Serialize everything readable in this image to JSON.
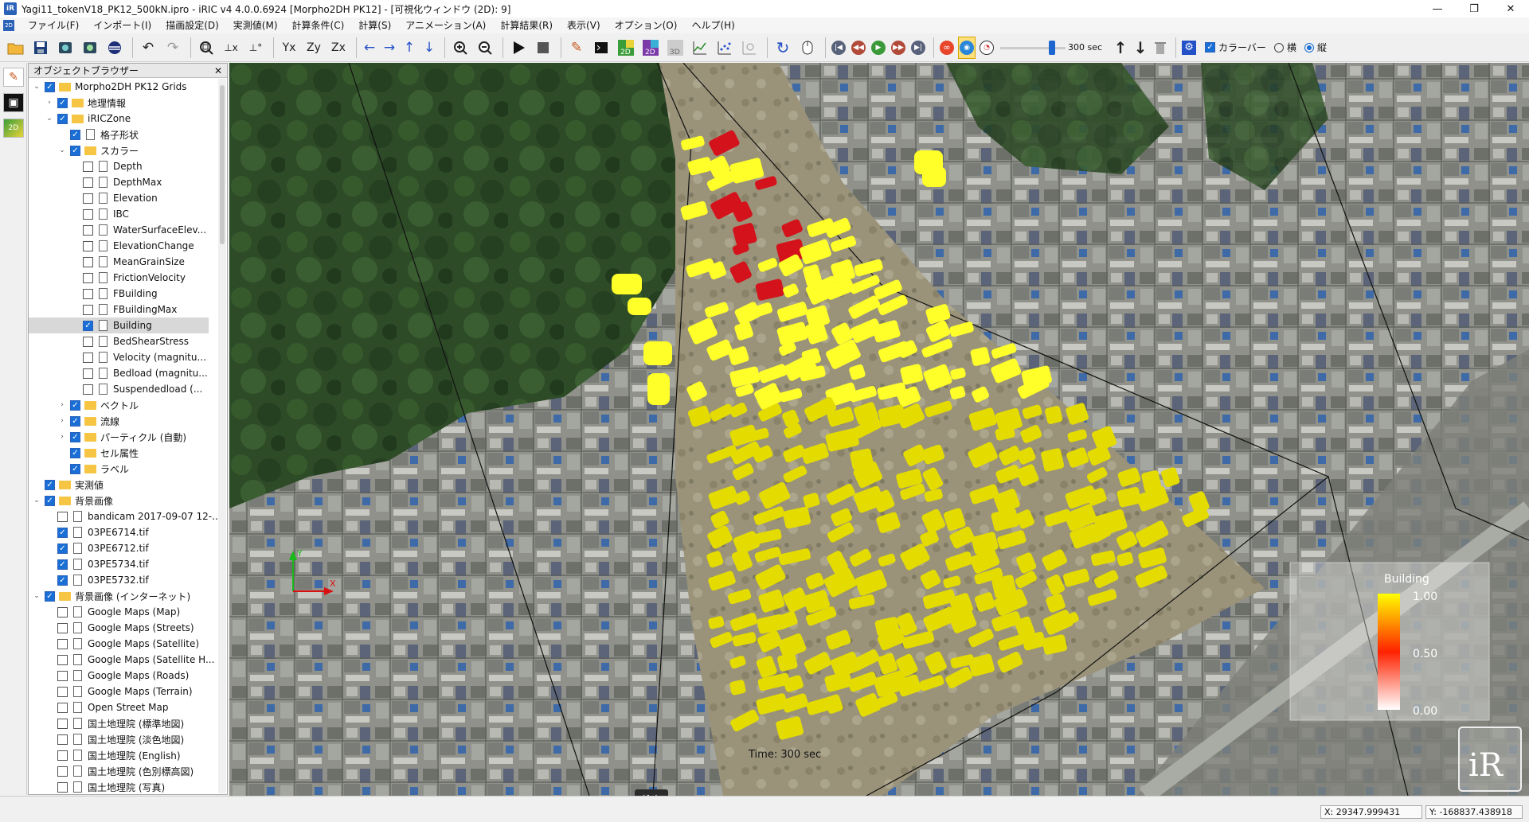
{
  "window": {
    "title": "Yagi11_tokenV18_PK12_500kN.ipro - iRIC v4 4.0.0.6924 [Morpho2DH PK12] - [可視化ウィンドウ (2D): 9]",
    "app_icon": "iR",
    "minimize": "—",
    "maximize": "❐",
    "close": "✕"
  },
  "menu": {
    "subwindow_icon": "2D",
    "items": [
      "ファイル(F)",
      "インポート(I)",
      "描画設定(D)",
      "実測値(M)",
      "計算条件(C)",
      "計算(S)",
      "アニメーション(A)",
      "計算結果(R)",
      "表示(V)",
      "オプション(O)",
      "ヘルプ(H)"
    ]
  },
  "toolbar": {
    "time_label": "300 sec",
    "time_fraction": 0.82,
    "colorbar_label": "カラーバー",
    "orient_h": "横",
    "orient_v": "縦",
    "colorbar_checked": true,
    "orientation": "vertical",
    "icons": {
      "open": "open-folder-icon",
      "save": "save-icon",
      "stop_animation": "stop-icon",
      "play": "play-icon"
    }
  },
  "left_strip": {
    "icons": [
      "edit-pencil-icon",
      "camera-icon",
      "view-2d-icon"
    ]
  },
  "object_browser": {
    "title": "オブジェクトブラウザー",
    "close": "✕",
    "items": [
      {
        "level": 0,
        "arrow": "v",
        "checked": true,
        "type": "folder",
        "label": "Morpho2DH PK12 Grids"
      },
      {
        "level": 1,
        "arrow": ">",
        "checked": true,
        "type": "folder",
        "label": "地理情報"
      },
      {
        "level": 1,
        "arrow": "v",
        "checked": true,
        "type": "folder",
        "label": "iRICZone"
      },
      {
        "level": 2,
        "arrow": "",
        "checked": true,
        "type": "doc",
        "label": "格子形状"
      },
      {
        "level": 2,
        "arrow": "v",
        "checked": true,
        "type": "folder",
        "label": "スカラー"
      },
      {
        "level": 3,
        "arrow": "",
        "checked": false,
        "type": "doc",
        "label": "Depth"
      },
      {
        "level": 3,
        "arrow": "",
        "checked": false,
        "type": "doc",
        "label": "DepthMax"
      },
      {
        "level": 3,
        "arrow": "",
        "checked": false,
        "type": "doc",
        "label": "Elevation"
      },
      {
        "level": 3,
        "arrow": "",
        "checked": false,
        "type": "doc",
        "label": "IBC"
      },
      {
        "level": 3,
        "arrow": "",
        "checked": false,
        "type": "doc",
        "label": "WaterSurfaceElev..."
      },
      {
        "level": 3,
        "arrow": "",
        "checked": false,
        "type": "doc",
        "label": "ElevationChange"
      },
      {
        "level": 3,
        "arrow": "",
        "checked": false,
        "type": "doc",
        "label": "MeanGrainSize"
      },
      {
        "level": 3,
        "arrow": "",
        "checked": false,
        "type": "doc",
        "label": "FrictionVelocity"
      },
      {
        "level": 3,
        "arrow": "",
        "checked": false,
        "type": "doc",
        "label": "FBuilding"
      },
      {
        "level": 3,
        "arrow": "",
        "checked": false,
        "type": "doc",
        "label": "FBuildingMax"
      },
      {
        "level": 3,
        "arrow": "",
        "checked": true,
        "type": "doc",
        "label": "Building",
        "selected": true
      },
      {
        "level": 3,
        "arrow": "",
        "checked": false,
        "type": "doc",
        "label": "BedShearStress"
      },
      {
        "level": 3,
        "arrow": "",
        "checked": false,
        "type": "doc",
        "label": "Velocity (magnitu..."
      },
      {
        "level": 3,
        "arrow": "",
        "checked": false,
        "type": "doc",
        "label": "Bedload (magnitu..."
      },
      {
        "level": 3,
        "arrow": "",
        "checked": false,
        "type": "doc",
        "label": "Suspendedload (..."
      },
      {
        "level": 2,
        "arrow": ">",
        "checked": true,
        "type": "folder",
        "label": "ベクトル"
      },
      {
        "level": 2,
        "arrow": ">",
        "checked": true,
        "type": "folder",
        "label": "流線"
      },
      {
        "level": 2,
        "arrow": ">",
        "checked": true,
        "type": "folder",
        "label": "パーティクル (自動)"
      },
      {
        "level": 2,
        "arrow": "",
        "checked": true,
        "type": "folder",
        "label": "セル属性"
      },
      {
        "level": 2,
        "arrow": "",
        "checked": true,
        "type": "folder",
        "label": "ラベル"
      },
      {
        "level": 0,
        "arrow": "",
        "checked": true,
        "type": "folder",
        "label": "実測値"
      },
      {
        "level": 0,
        "arrow": "v",
        "checked": true,
        "type": "folder",
        "label": "背景画像"
      },
      {
        "level": 1,
        "arrow": "",
        "checked": false,
        "type": "doc",
        "label": "bandicam 2017-09-07 12-..."
      },
      {
        "level": 1,
        "arrow": "",
        "checked": true,
        "type": "doc",
        "label": "03PE6714.tif"
      },
      {
        "level": 1,
        "arrow": "",
        "checked": true,
        "type": "doc",
        "label": "03PE6712.tif"
      },
      {
        "level": 1,
        "arrow": "",
        "checked": true,
        "type": "doc",
        "label": "03PE5734.tif"
      },
      {
        "level": 1,
        "arrow": "",
        "checked": true,
        "type": "doc",
        "label": "03PE5732.tif"
      },
      {
        "level": 0,
        "arrow": "v",
        "checked": true,
        "type": "folder",
        "label": "背景画像 (インターネット)"
      },
      {
        "level": 1,
        "arrow": "",
        "checked": false,
        "type": "doc",
        "label": "Google Maps (Map)"
      },
      {
        "level": 1,
        "arrow": "",
        "checked": false,
        "type": "doc",
        "label": "Google Maps (Streets)"
      },
      {
        "level": 1,
        "arrow": "",
        "checked": false,
        "type": "doc",
        "label": "Google Maps (Satellite)"
      },
      {
        "level": 1,
        "arrow": "",
        "checked": false,
        "type": "doc",
        "label": "Google Maps (Satellite H..."
      },
      {
        "level": 1,
        "arrow": "",
        "checked": false,
        "type": "doc",
        "label": "Google Maps (Roads)"
      },
      {
        "level": 1,
        "arrow": "",
        "checked": false,
        "type": "doc",
        "label": "Google Maps (Terrain)"
      },
      {
        "level": 1,
        "arrow": "",
        "checked": false,
        "type": "doc",
        "label": "Open Street Map"
      },
      {
        "level": 1,
        "arrow": "",
        "checked": false,
        "type": "doc",
        "label": "国土地理院 (標準地図)"
      },
      {
        "level": 1,
        "arrow": "",
        "checked": false,
        "type": "doc",
        "label": "国土地理院 (淡色地図)"
      },
      {
        "level": 1,
        "arrow": "",
        "checked": false,
        "type": "doc",
        "label": "国土地理院 (English)"
      },
      {
        "level": 1,
        "arrow": "",
        "checked": false,
        "type": "doc",
        "label": "国土地理院 (色別標高図)"
      },
      {
        "level": 1,
        "arrow": "",
        "checked": false,
        "type": "doc",
        "label": "国土地理院 (写真)"
      }
    ]
  },
  "map": {
    "time_text": "Time: 300 sec",
    "colorbar": {
      "title": "Building",
      "max": "1.00",
      "mid": "0.50",
      "min": "0.00",
      "colors": [
        "#ffff00",
        "#ff3300",
        "#ffffff"
      ]
    },
    "axes": {
      "x": "X",
      "y": "Y"
    },
    "logo": "iR",
    "colors": {
      "forest": "#2c4a26",
      "urban": "#8a8d86",
      "debris": "#9b9377",
      "building_high": "#e4dc00",
      "building_low": "#ffff2a",
      "hot": "#d4121b"
    }
  },
  "tooltip": "検索",
  "status": {
    "x": "X: 29347.999431",
    "y": "Y: -168837.438918"
  }
}
